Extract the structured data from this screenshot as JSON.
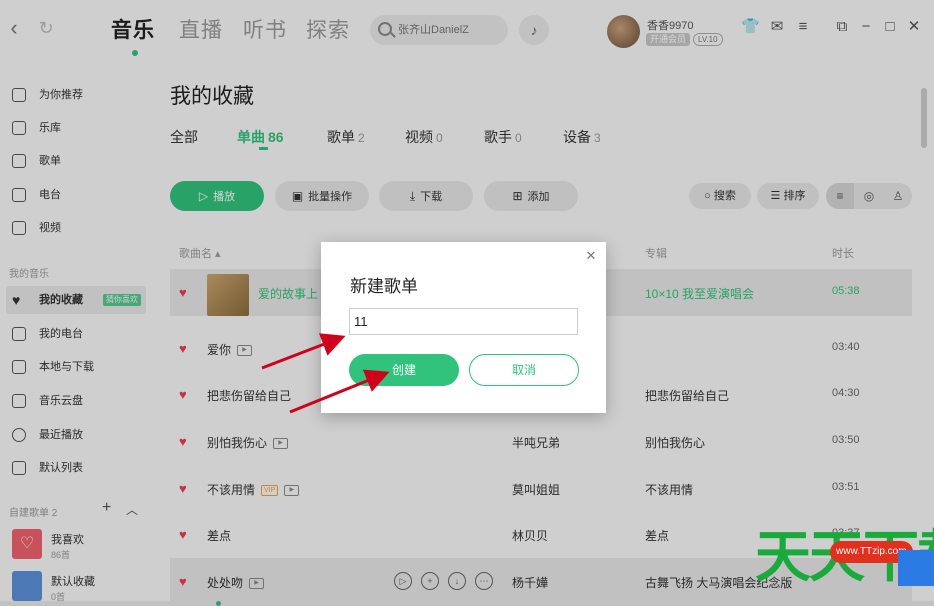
{
  "app": {
    "main_tabs": [
      "音乐",
      "直播",
      "听书",
      "探索"
    ],
    "search_placeholder": "张齐山DanielZ",
    "user": {
      "name": "香香9970",
      "vip_label": "开通会员",
      "level": "LV.10"
    },
    "window_icons": [
      "shirt-icon",
      "mail-icon",
      "menu-icon",
      "mini-mode-icon",
      "minimize-icon",
      "maximize-icon",
      "close-icon"
    ]
  },
  "sidebar": {
    "items": [
      {
        "label": "为你推荐",
        "icon": "recommend-icon"
      },
      {
        "label": "乐库",
        "icon": "library-icon"
      },
      {
        "label": "歌单",
        "icon": "playlist-icon"
      },
      {
        "label": "电台",
        "icon": "radio-icon"
      },
      {
        "label": "视频",
        "icon": "video-icon"
      }
    ],
    "my_music_label": "我的音乐",
    "my_items": [
      {
        "label": "我的收藏",
        "icon": "heart-icon",
        "badge": "猜你喜欢"
      },
      {
        "label": "我的电台",
        "icon": "radio-icon"
      },
      {
        "label": "本地与下载",
        "icon": "download-icon"
      },
      {
        "label": "音乐云盘",
        "icon": "cloud-icon"
      },
      {
        "label": "最近播放",
        "icon": "clock-icon"
      },
      {
        "label": "默认列表",
        "icon": "list-icon"
      }
    ],
    "created_label": "自建歌单 2",
    "playlists": [
      {
        "name": "我喜欢",
        "count": "86首",
        "color": "#f0616d"
      },
      {
        "name": "默认收藏",
        "count": "0首",
        "color": "#5b8fd9"
      }
    ]
  },
  "main": {
    "title": "我的收藏",
    "tabs": [
      {
        "label": "全部",
        "count": ""
      },
      {
        "label": "单曲",
        "count": "86"
      },
      {
        "label": "歌单",
        "count": "2"
      },
      {
        "label": "视频",
        "count": "0"
      },
      {
        "label": "歌手",
        "count": "0"
      },
      {
        "label": "设备",
        "count": "3"
      }
    ],
    "toolbar": {
      "play": "播放",
      "batch": "批量操作",
      "download": "下载",
      "add": "添加",
      "search": "搜索",
      "sort": "排序"
    },
    "columns": {
      "song": "歌曲名",
      "album": "专辑",
      "duration": "时长"
    },
    "songs": [
      {
        "title": "爱的故事上",
        "singer": "",
        "album": "10×10 我至爱演唱会",
        "duration": "05:38",
        "mv": false,
        "vip": false
      },
      {
        "title": "爱你",
        "singer": "",
        "album": "",
        "duration": "03:40",
        "mv": true,
        "vip": false
      },
      {
        "title": "把悲伤留给自己",
        "singer": "",
        "album": "把悲伤留给自己",
        "duration": "04:30",
        "mv": false,
        "vip": false
      },
      {
        "title": "别怕我伤心",
        "singer": "半吨兄弟",
        "album": "别怕我伤心",
        "duration": "03:50",
        "mv": true,
        "vip": false
      },
      {
        "title": "不该用情",
        "singer": "莫叫姐姐",
        "album": "不该用情",
        "duration": "03:51",
        "mv": true,
        "vip": true
      },
      {
        "title": "差点",
        "singer": "林贝贝",
        "album": "差点",
        "duration": "03:37",
        "mv": false,
        "vip": false
      },
      {
        "title": "处处吻",
        "singer": "杨千嬅",
        "album": "古舞飞扬 大马演唱会纪念版",
        "duration": "",
        "mv": true,
        "vip": false
      }
    ],
    "vip_tag": "VIP",
    "mv_tag": "▶"
  },
  "dialog": {
    "title": "新建歌单",
    "input_value": "11",
    "create_label": "创建",
    "cancel_label": "取消"
  },
  "watermark": {
    "text": "天天下载",
    "url": "www.TTzip.com"
  },
  "colors": {
    "accent": "#31c27c",
    "heart": "#f03a50",
    "arrow": "#d0021b"
  }
}
